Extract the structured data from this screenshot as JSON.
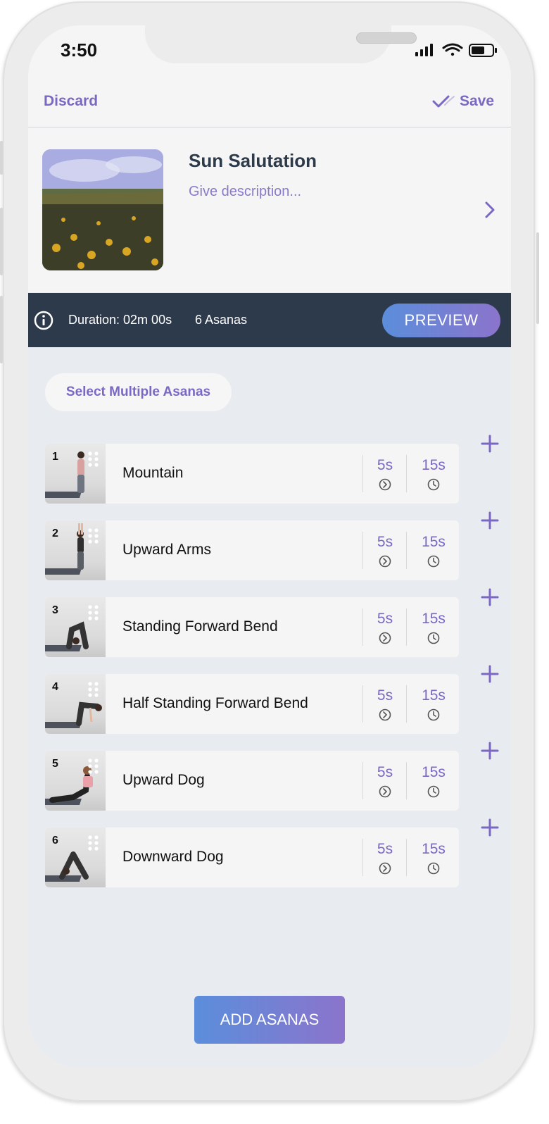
{
  "status_bar": {
    "time": "3:50"
  },
  "nav": {
    "discard_label": "Discard",
    "save_label": "Save"
  },
  "sequence": {
    "title": "Sun Salutation",
    "description_placeholder": "Give description..."
  },
  "info_bar": {
    "duration": "Duration: 02m 00s",
    "asana_count": "6 Asanas",
    "preview_label": "PREVIEW"
  },
  "select_multiple_label": "Select Multiple Asanas",
  "asanas": [
    {
      "number": "1",
      "name": "Mountain",
      "transition": "5s",
      "hold": "15s"
    },
    {
      "number": "2",
      "name": "Upward Arms",
      "transition": "5s",
      "hold": "15s"
    },
    {
      "number": "3",
      "name": "Standing Forward Bend",
      "transition": "5s",
      "hold": "15s"
    },
    {
      "number": "4",
      "name": "Half Standing Forward Bend",
      "transition": "5s",
      "hold": "15s"
    },
    {
      "number": "5",
      "name": "Upward Dog",
      "transition": "5s",
      "hold": "15s"
    },
    {
      "number": "6",
      "name": "Downward Dog",
      "transition": "5s",
      "hold": "15s"
    }
  ],
  "add_button_label": "ADD ASANAS",
  "colors": {
    "accent": "#7b68c4",
    "info_bar_bg": "#2d3a4c",
    "gradient_start": "#5b8edb",
    "gradient_end": "#8b74cc"
  }
}
